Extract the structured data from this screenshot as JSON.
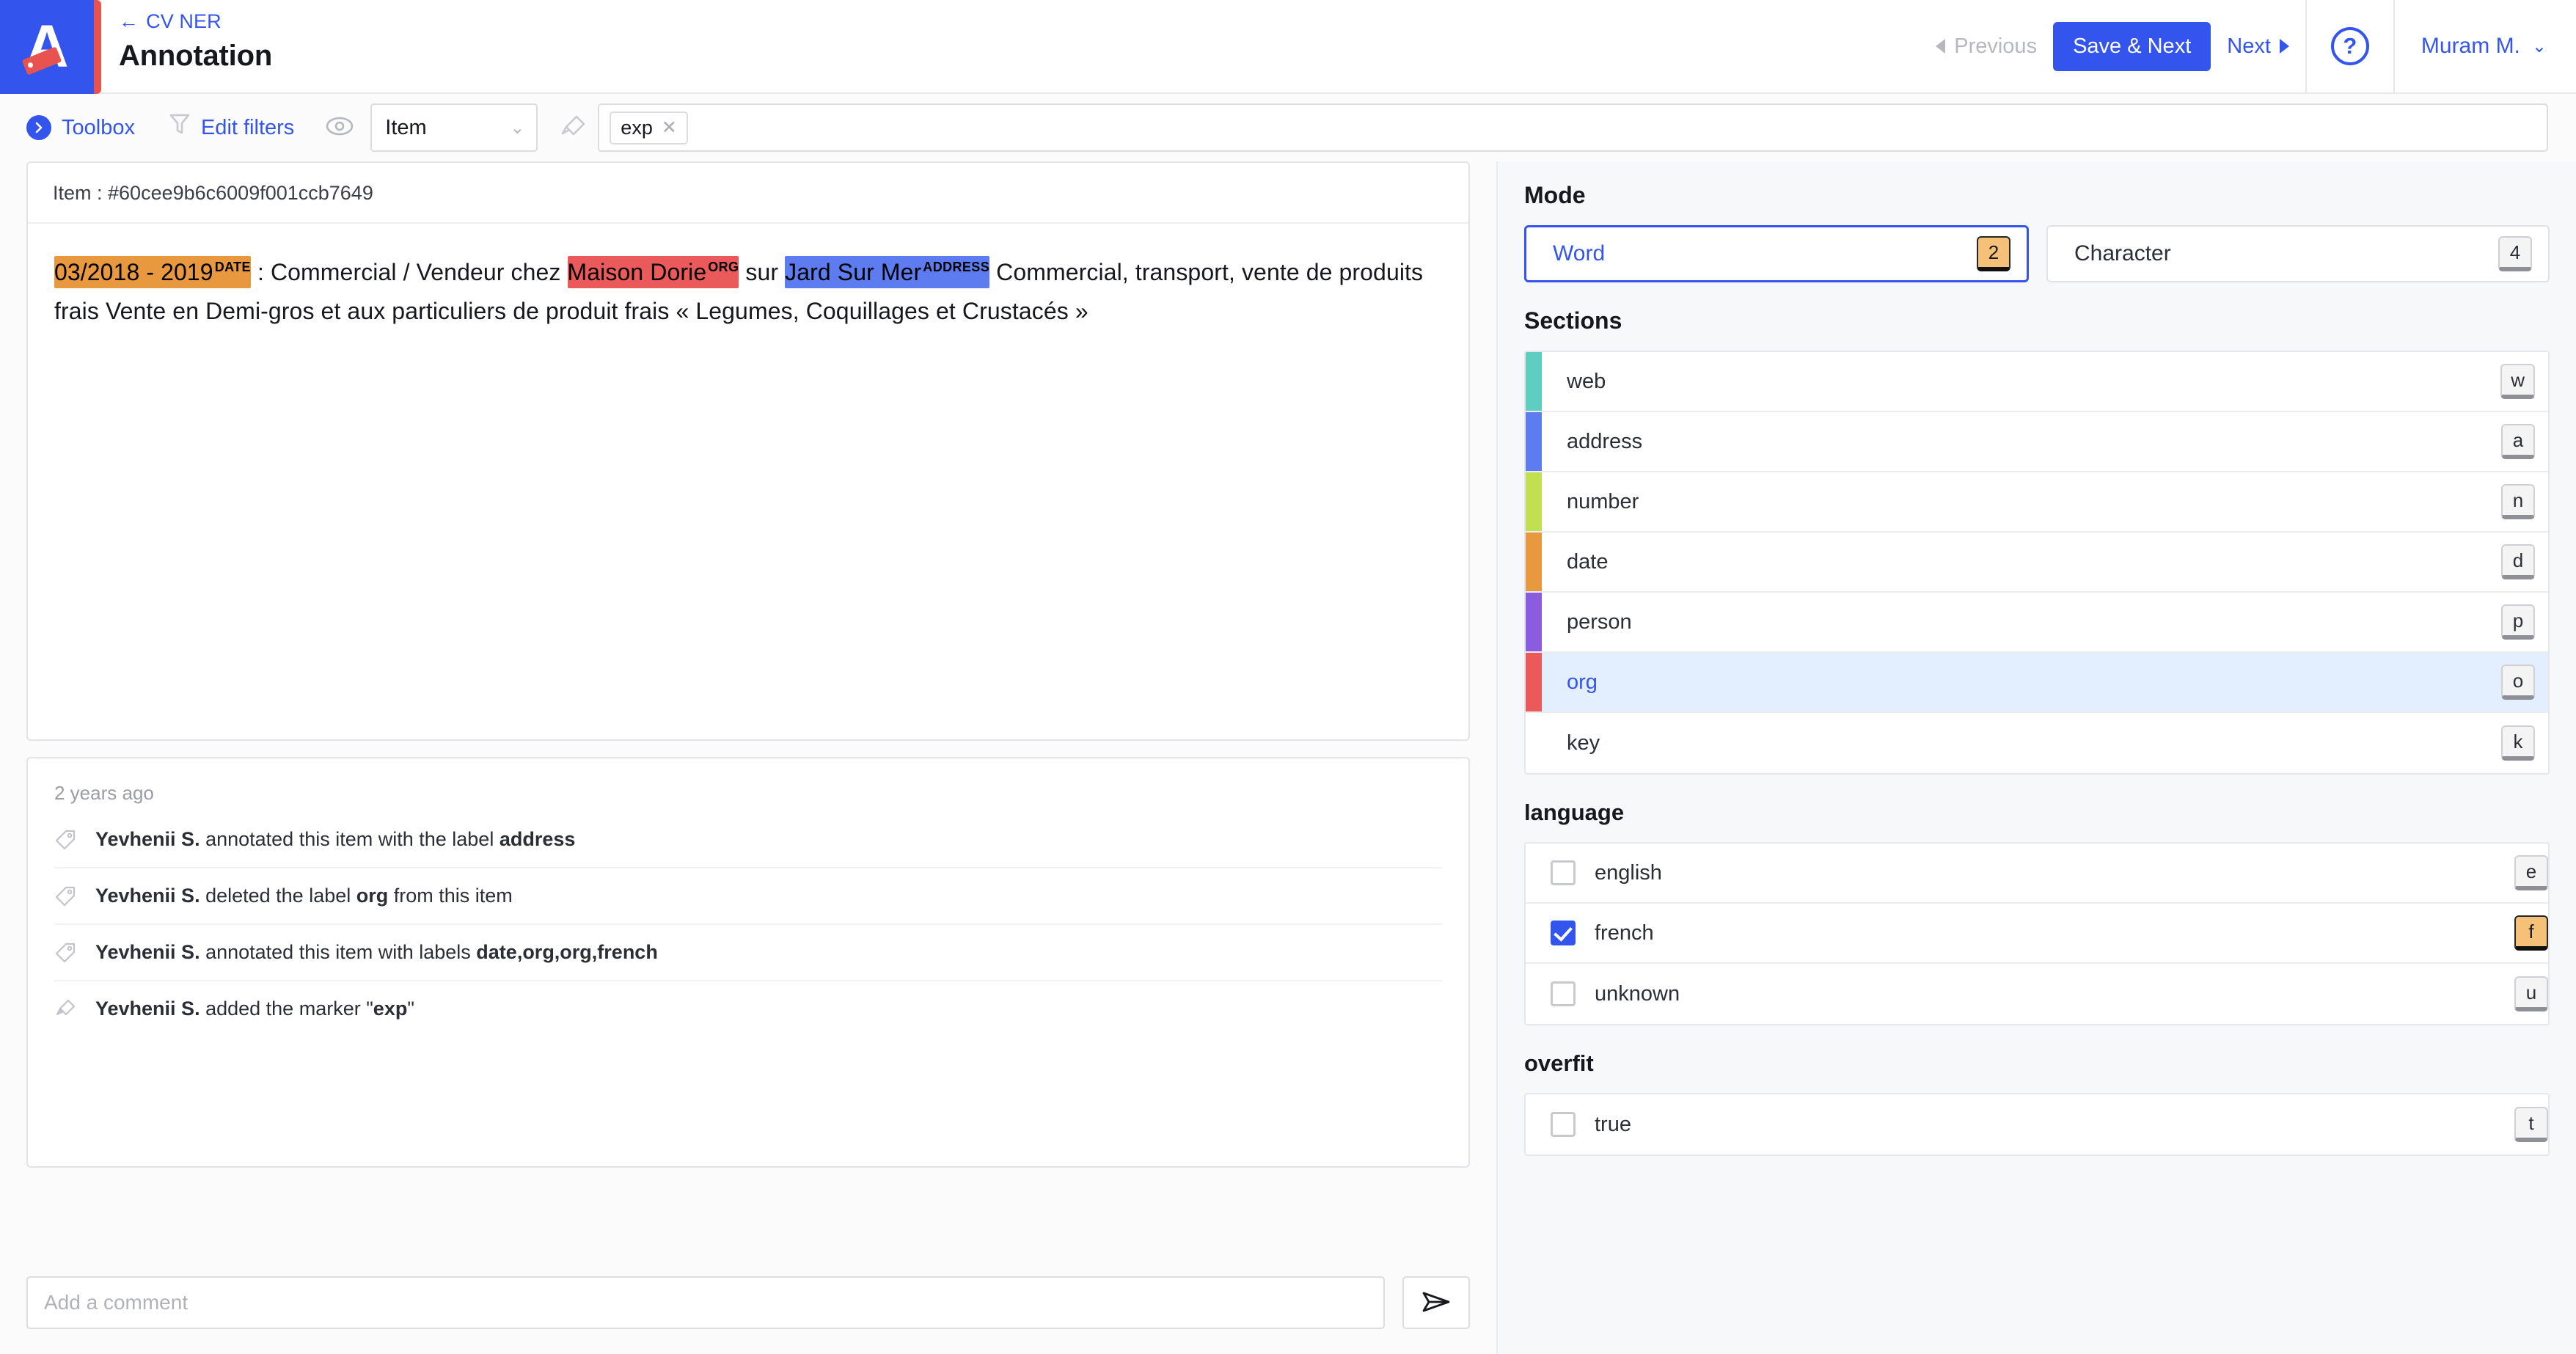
{
  "header": {
    "logo_letter": "A",
    "back_arrow": "←",
    "breadcrumb": "CV NER",
    "title": "Annotation",
    "previous_label": "Previous",
    "save_next_label": "Save & Next",
    "next_label": "Next",
    "help_glyph": "?",
    "user_name": "Muram M.",
    "user_chevron": "⌄"
  },
  "toolbar": {
    "toolbox_label": "Toolbox",
    "edit_filters_label": "Edit filters",
    "item_select_value": "Item",
    "item_select_chevron": "⌄",
    "marker_chip_label": "exp",
    "marker_chip_remove": "✕"
  },
  "document": {
    "item_header": "Item : #60cee9b6c6009f001ccb7649",
    "segments": [
      {
        "text": "03/2018 - 2019",
        "label": "DATE",
        "color": "#e8983f"
      },
      {
        "text": " : Commercial / Vendeur chez ",
        "label": "",
        "color": ""
      },
      {
        "text": "Maison Dorie",
        "label": "ORG",
        "color": "#ea5a5a"
      },
      {
        "text": " sur ",
        "label": "",
        "color": ""
      },
      {
        "text": "Jard Sur Mer",
        "label": "ADDRESS",
        "color": "#5c7cf0"
      },
      {
        "text": " Commercial, transport, vente de produits frais Vente en Demi-gros et aux particuliers de produit frais « Legumes, Coquillages et Crustacés »",
        "label": "",
        "color": ""
      }
    ]
  },
  "history": {
    "timestamp": "2 years ago",
    "entries": [
      {
        "icon": "tag-icon",
        "actor": "Yevhenii S.",
        "action": " annotated this item with the label ",
        "target": "address",
        "suffix": ""
      },
      {
        "icon": "tag-icon",
        "actor": "Yevhenii S.",
        "action": " deleted the label ",
        "target": "org",
        "suffix": " from this item"
      },
      {
        "icon": "tag-icon",
        "actor": "Yevhenii S.",
        "action": " annotated this item with labels ",
        "target": "date,org,org,french",
        "suffix": ""
      },
      {
        "icon": "marker-icon",
        "actor": "Yevhenii S.",
        "action": " added the marker \"",
        "target": "exp",
        "suffix": "\""
      }
    ]
  },
  "comment": {
    "placeholder": "Add a comment",
    "value": "",
    "send_icon": "send-icon"
  },
  "panel": {
    "mode_title": "Mode",
    "modes": [
      {
        "label": "Word",
        "key": "2",
        "active": true
      },
      {
        "label": "Character",
        "key": "4",
        "active": false
      }
    ],
    "sections_title": "Sections",
    "sections": [
      {
        "label": "web",
        "key": "w",
        "color": "#5fcdc2",
        "selected": false
      },
      {
        "label": "address",
        "key": "a",
        "color": "#5c7cf0",
        "selected": false
      },
      {
        "label": "number",
        "key": "n",
        "color": "#c1e04f",
        "selected": false
      },
      {
        "label": "date",
        "key": "d",
        "color": "#e8983f",
        "selected": false
      },
      {
        "label": "person",
        "key": "p",
        "color": "#8b5be0",
        "selected": false
      },
      {
        "label": "org",
        "key": "o",
        "color": "#ea5a5a",
        "selected": true
      },
      {
        "label": "key",
        "key": "k",
        "color": "#f7e košík",
        "selected": false
      }
    ],
    "language_title": "language",
    "languages": [
      {
        "label": "english",
        "key": "e",
        "checked": false,
        "key_accent": false
      },
      {
        "label": "french",
        "key": "f",
        "checked": true,
        "key_accent": true
      },
      {
        "label": "unknown",
        "key": "u",
        "checked": false,
        "key_accent": false
      }
    ],
    "overfit_title": "overfit",
    "overfit": [
      {
        "label": "true",
        "key": "t",
        "checked": false,
        "key_accent": false
      }
    ]
  },
  "colors": {
    "brand_blue": "#3355ee",
    "accent_red": "#e8534f",
    "key_accent": "#f5c178",
    "selected_row": "#e3efff"
  }
}
